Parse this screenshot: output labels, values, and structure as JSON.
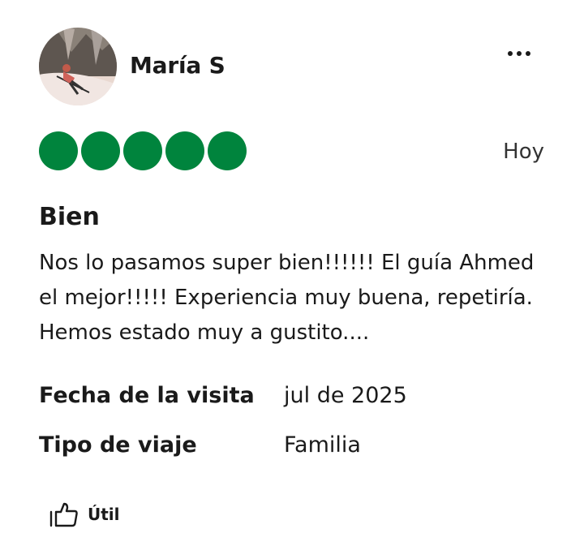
{
  "review": {
    "reviewer_name": "María S",
    "avatar_icon": "user-avatar-photo-icon",
    "more_icon": "more-options-icon",
    "rating": {
      "value": 5,
      "max": 5,
      "color": "#00843d"
    },
    "date": "Hoy",
    "title": "Bien",
    "body": "Nos lo pasamos super bien!!!!!! El guía Ahmed el mejor!!!!! Experiencia muy buena, repetiría. Hemos estado muy a gustito....",
    "details": [
      {
        "label": "Fecha de la visita",
        "value": "jul de 2025"
      },
      {
        "label": "Tipo de viaje",
        "value": "Familia"
      }
    ],
    "helpful": {
      "icon": "thumbs-up-icon",
      "label": "Útil"
    }
  }
}
